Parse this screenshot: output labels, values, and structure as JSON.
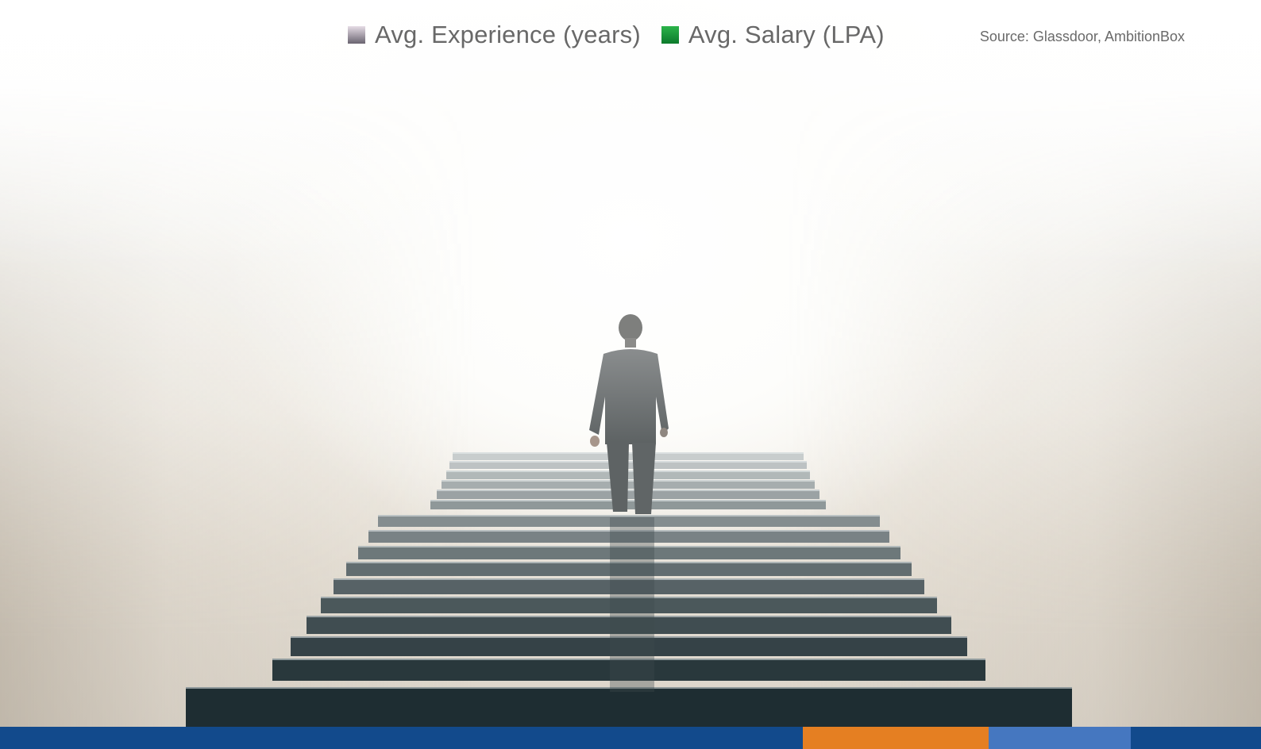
{
  "legend": {
    "items": [
      {
        "label": "Avg. Experience (years)",
        "swatch_colors": [
          "#e6dde6",
          "#6a6470"
        ]
      },
      {
        "label": "Avg. Salary (LPA)",
        "swatch_colors": [
          "#2bb34a",
          "#0c7a2c"
        ]
      }
    ]
  },
  "source": {
    "text": "Source: Glassdoor, AmbitionBox"
  },
  "background": {
    "image": "man-climbing-stairs-in-fog",
    "stair_color": "#2e3e42",
    "fog_color": "#f7f5f1"
  },
  "bottom_bar": {
    "colors": [
      "#124a8c",
      "#e57f22",
      "#4577c0",
      "#124a8c"
    ]
  }
}
